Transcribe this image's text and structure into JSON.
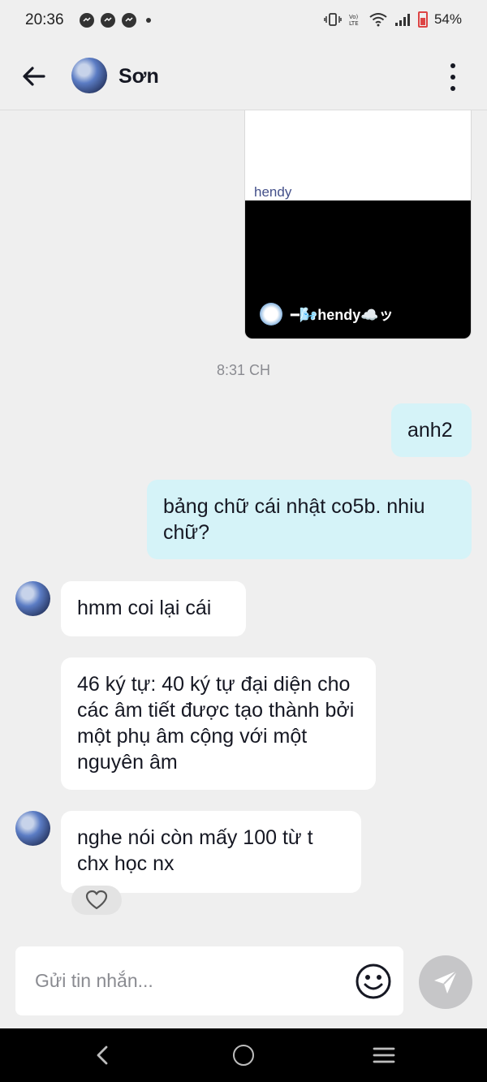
{
  "status_bar": {
    "time": "20:36",
    "battery": "54%"
  },
  "header": {
    "contact_name": "Sơn"
  },
  "media_card": {
    "caption": "hendy",
    "author": "━🌬️hendy☁️ッ"
  },
  "timestamp": "8:31 CH",
  "messages": [
    {
      "side": "sent",
      "text": "anh2"
    },
    {
      "side": "sent",
      "text": "bảng chữ cái nhật co5b. nhiu chữ?"
    },
    {
      "side": "received",
      "text": "hmm coi lại cái"
    },
    {
      "side": "received",
      "text": "46 ký tự: 40 ký tự đại diện cho các âm tiết được tạo thành bởi một phụ âm cộng với một nguyên âm"
    },
    {
      "side": "received",
      "text": "nghe nói còn mấy 100 từ t chx học nx"
    }
  ],
  "composer": {
    "placeholder": "Gửi tin nhắn..."
  },
  "colors": {
    "sent_bubble": "#d5f3f8",
    "received_bubble": "#ffffff",
    "background": "#efefef"
  }
}
